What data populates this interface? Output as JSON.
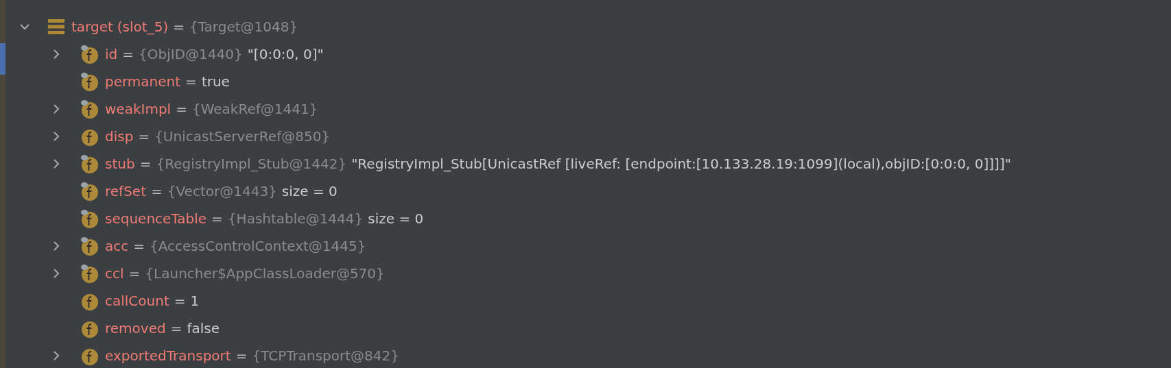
{
  "root": {
    "name": "target",
    "slot": "(slot_5)",
    "eq": "=",
    "type": "{Target@1048}",
    "expanded": true
  },
  "fields": [
    {
      "name": "id",
      "eq": "=",
      "type": "{ObjID@1440}",
      "value": "\"[0:0:0, 0]\"",
      "expandable": true,
      "final": true
    },
    {
      "name": "permanent",
      "eq": "=",
      "value": "true",
      "expandable": false,
      "final": true
    },
    {
      "name": "weakImpl",
      "eq": "=",
      "type": "{WeakRef@1441}",
      "expandable": true,
      "final": true
    },
    {
      "name": "disp",
      "eq": "=",
      "type": "{UnicastServerRef@850}",
      "expandable": true,
      "final": false
    },
    {
      "name": "stub",
      "eq": "=",
      "type": "{RegistryImpl_Stub@1442}",
      "value": "\"RegistryImpl_Stub[UnicastRef [liveRef: [endpoint:[10.133.28.19:1099](local),objID:[0:0:0, 0]]]]\"",
      "expandable": true,
      "final": true
    },
    {
      "name": "refSet",
      "eq": "=",
      "type": "{Vector@1443}",
      "value": "size = 0",
      "expandable": false,
      "final": true
    },
    {
      "name": "sequenceTable",
      "eq": "=",
      "type": "{Hashtable@1444}",
      "value": "size = 0",
      "expandable": false,
      "final": true
    },
    {
      "name": "acc",
      "eq": "=",
      "type": "{AccessControlContext@1445}",
      "expandable": true,
      "final": true
    },
    {
      "name": "ccl",
      "eq": "=",
      "type": "{Launcher$AppClassLoader@570}",
      "expandable": true,
      "final": true
    },
    {
      "name": "callCount",
      "eq": "=",
      "value": "1",
      "expandable": false,
      "final": false
    },
    {
      "name": "removed",
      "eq": "=",
      "value": "false",
      "expandable": false,
      "final": false
    },
    {
      "name": "exportedTransport",
      "eq": "=",
      "type": "{TCPTransport@842}",
      "expandable": true,
      "final": false
    }
  ]
}
